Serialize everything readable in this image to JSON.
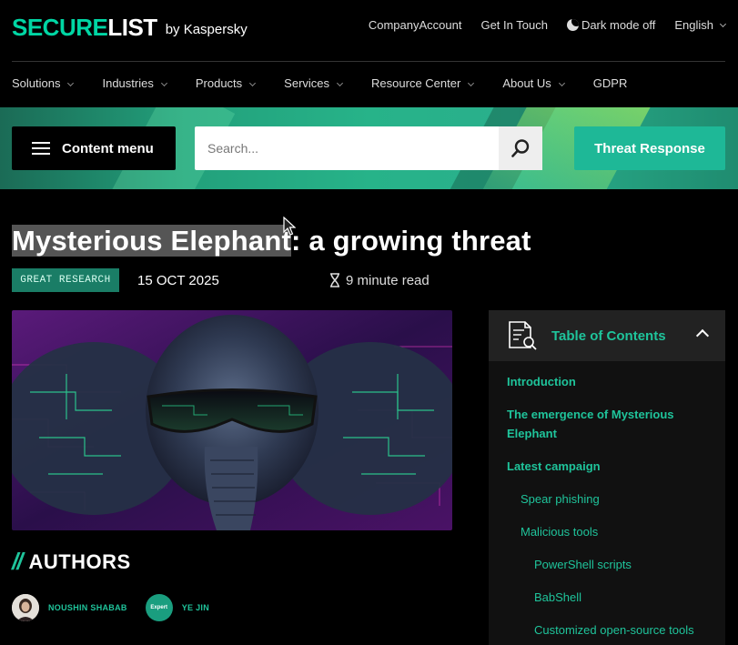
{
  "brand": {
    "logo_secure": "SECURE",
    "logo_list": "LIST",
    "by": "by Kaspersky",
    "accent": "#00d6a4"
  },
  "top_links": {
    "company_account": "CompanyAccount",
    "get_in_touch": "Get In Touch",
    "dark_mode": "Dark mode off",
    "language": "English"
  },
  "nav": [
    {
      "label": "Solutions",
      "caret": true
    },
    {
      "label": "Industries",
      "caret": true
    },
    {
      "label": "Products",
      "caret": true
    },
    {
      "label": "Services",
      "caret": true
    },
    {
      "label": "Resource Center",
      "caret": true
    },
    {
      "label": "About Us",
      "caret": true
    },
    {
      "label": "GDPR",
      "caret": false
    }
  ],
  "toolbar": {
    "content_menu": "Content menu",
    "search_placeholder": "Search...",
    "threat_response": "Threat Response"
  },
  "article": {
    "title_highlighted": "Mysterious Elephant",
    "title_rest": ": a growing threat",
    "tag": "GREAT RESEARCH",
    "date": "15 OCT 2025",
    "read_time": "9 minute read",
    "authors_heading": "AUTHORS",
    "authors_slashes": "//",
    "authors": [
      {
        "name": "NOUSHIN SHABAB",
        "avatar_text": ""
      },
      {
        "name": "YE JIN",
        "avatar_text": "Expert"
      }
    ]
  },
  "toc": {
    "title": "Table of Contents",
    "items": [
      {
        "label": "Introduction",
        "level": 0
      },
      {
        "label": "The emergence of Mysterious Elephant",
        "level": 0
      },
      {
        "label": "Latest campaign",
        "level": 0
      },
      {
        "label": "Spear phishing",
        "level": 1
      },
      {
        "label": "Malicious tools",
        "level": 1
      },
      {
        "label": "PowerShell scripts",
        "level": 2
      },
      {
        "label": "BabShell",
        "level": 2
      },
      {
        "label": "Customized open-source tools",
        "level": 2
      }
    ]
  }
}
